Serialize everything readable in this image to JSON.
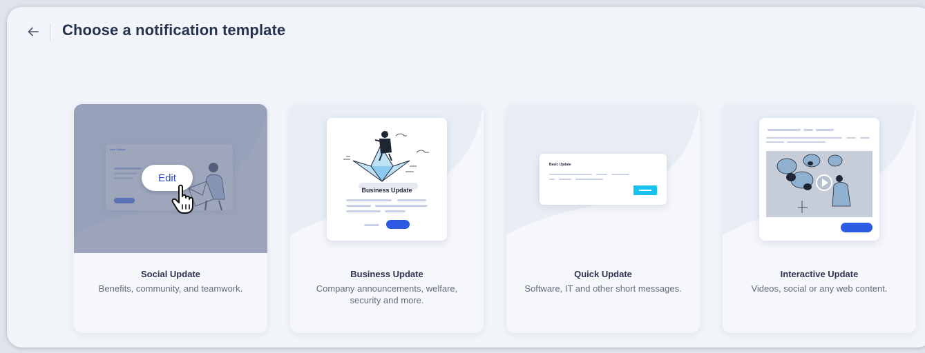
{
  "header": {
    "back_icon": "arrow-left-icon",
    "title": "Choose a notification template"
  },
  "colors": {
    "accent": "#2d5be3",
    "cyan": "#18c2f0",
    "title": "#26324f",
    "panel": "#f1f4f9"
  },
  "cards": [
    {
      "title": "Social Update",
      "description": "Benefits, community, and teamwork.",
      "preview_heading": "New Update",
      "hover": true,
      "edit_label": "Edit"
    },
    {
      "title": "Business Update",
      "description": "Company announcements, welfare, security and more.",
      "preview_heading": "Business Update"
    },
    {
      "title": "Quick Update",
      "description": "Software, IT and other short messages.",
      "preview_heading": "Basic Update"
    },
    {
      "title": "Interactive Update",
      "description": "Videos, social or any web content."
    }
  ]
}
